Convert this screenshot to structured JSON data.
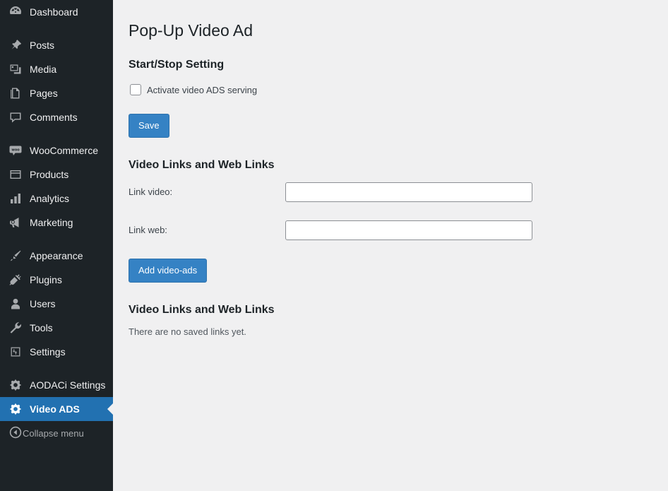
{
  "sidebar": {
    "groups": [
      {
        "items": [
          {
            "label": "Dashboard",
            "icon": "dashboard-icon",
            "current": false
          }
        ]
      },
      {
        "items": [
          {
            "label": "Posts",
            "icon": "pin-icon",
            "current": false
          },
          {
            "label": "Media",
            "icon": "media-icon",
            "current": false
          },
          {
            "label": "Pages",
            "icon": "pages-icon",
            "current": false
          },
          {
            "label": "Comments",
            "icon": "comments-icon",
            "current": false
          }
        ]
      },
      {
        "items": [
          {
            "label": "WooCommerce",
            "icon": "woocommerce-icon",
            "current": false
          },
          {
            "label": "Products",
            "icon": "products-icon",
            "current": false
          },
          {
            "label": "Analytics",
            "icon": "analytics-icon",
            "current": false
          },
          {
            "label": "Marketing",
            "icon": "megaphone-icon",
            "current": false
          }
        ]
      },
      {
        "items": [
          {
            "label": "Appearance",
            "icon": "appearance-brush-icon",
            "current": false
          },
          {
            "label": "Plugins",
            "icon": "plugins-plug-icon",
            "current": false
          },
          {
            "label": "Users",
            "icon": "users-icon",
            "current": false
          },
          {
            "label": "Tools",
            "icon": "tools-wrench-icon",
            "current": false
          },
          {
            "label": "Settings",
            "icon": "settings-sliders-icon",
            "current": false
          }
        ]
      },
      {
        "items": [
          {
            "label": "AODACi Settings",
            "icon": "gear-icon",
            "current": false
          },
          {
            "label": "Video ADS",
            "icon": "gear-icon",
            "current": true
          }
        ]
      }
    ],
    "collapse": {
      "label": "Collapse menu",
      "icon": "collapse-arrow-icon"
    },
    "colors": {
      "background": "#1d2327",
      "current_background": "#2271b1",
      "text": "#f0f0f1"
    }
  },
  "main": {
    "page_title": "Pop-Up Video Ad",
    "start_stop": {
      "heading": "Start/Stop Setting",
      "activate_label": "Activate video ADS serving",
      "activate_checked": false,
      "save_label": "Save"
    },
    "links_form": {
      "heading": "Video Links and Web Links",
      "video_label": "Link video:",
      "video_value": "",
      "video_placeholder": "",
      "web_label": "Link web:",
      "web_value": "",
      "web_placeholder": "",
      "add_label": "Add video-ads"
    },
    "saved_links": {
      "heading": "Video Links and Web Links",
      "empty_message": "There are no saved links yet."
    },
    "colors": {
      "background": "#f0f0f1",
      "button": "#3582c4",
      "heading": "#1d2327"
    }
  }
}
